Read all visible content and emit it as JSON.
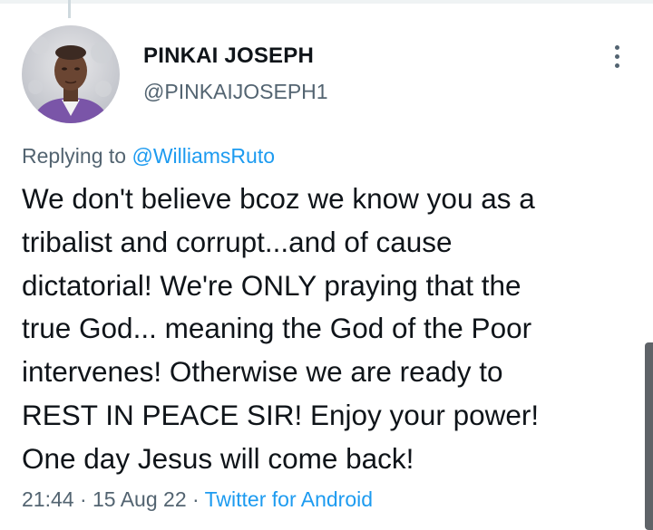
{
  "author": {
    "display_name": "PINKAI JOSEPH",
    "handle": "@PINKAIJOSEPH1"
  },
  "reply": {
    "prefix": "Replying to",
    "mention": "@WilliamsRuto"
  },
  "tweet": {
    "text": "We don't believe bcoz we know you as a\ntribalist and corrupt...and of cause\ndictatorial! We're ONLY praying that the\ntrue God... meaning the God of the Poor\nintervenes! Otherwise we are ready to\nREST IN PEACE SIR!  Enjoy your power!\nOne day Jesus will come back!"
  },
  "meta": {
    "time": "21:44",
    "sep1": " · ",
    "date": "15 Aug 22",
    "sep2": " · ",
    "source": "Twitter for Android"
  },
  "icons": {
    "more": "more-vertical-icon"
  },
  "colors": {
    "link": "#1d9bf0",
    "secondary_text": "#536471",
    "primary_text": "#0f1419"
  }
}
